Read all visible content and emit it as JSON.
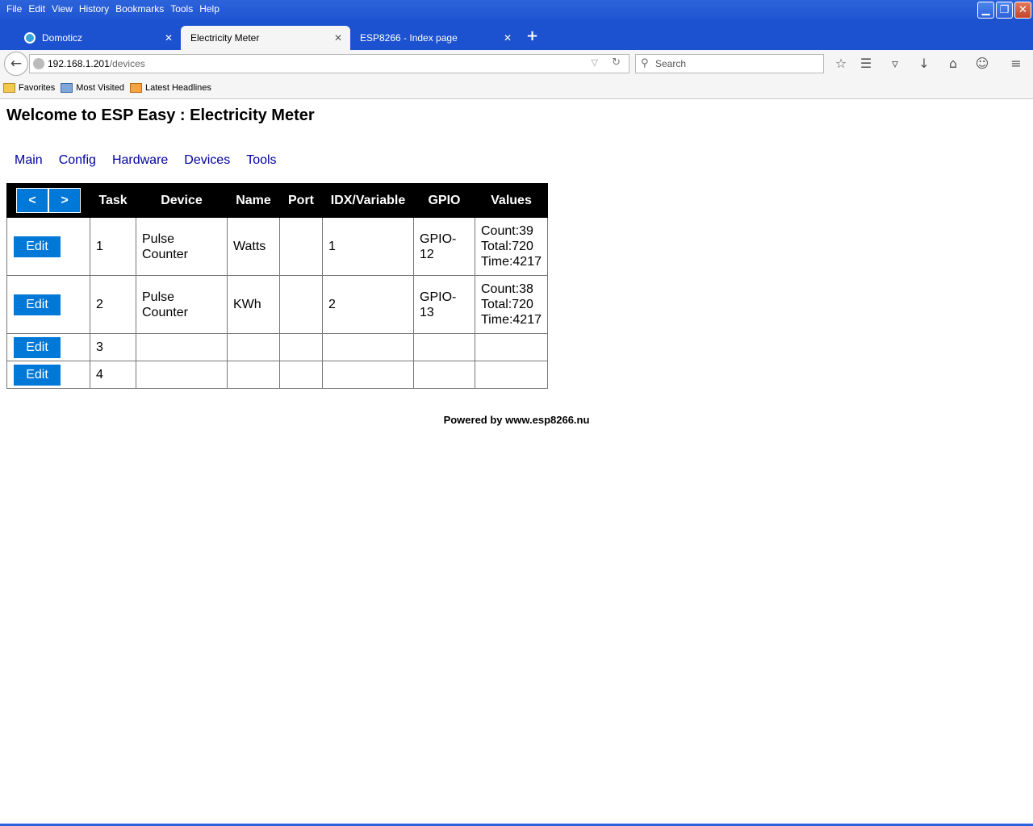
{
  "menubar": {
    "items": [
      "File",
      "Edit",
      "View",
      "History",
      "Bookmarks",
      "Tools",
      "Help"
    ]
  },
  "window_controls": {
    "minimize_icon": "minimize-icon",
    "restore_icon": "restore-icon",
    "close_icon": "close-icon"
  },
  "tabs": [
    {
      "title": "Domoticz",
      "active": false
    },
    {
      "title": "Electricity Meter",
      "active": true
    },
    {
      "title": "ESP8266 - Index page",
      "active": false
    }
  ],
  "navbar": {
    "url_host": "192.168.1.201",
    "url_path": "/devices",
    "search_placeholder": "Search"
  },
  "bookmarks": [
    "Favorites",
    "Most Visited",
    "Latest Headlines"
  ],
  "page": {
    "title": "Welcome to ESP Easy : Electricity Meter",
    "nav": [
      "Main",
      "Config",
      "Hardware",
      "Devices",
      "Tools"
    ],
    "prev_label": "<",
    "next_label": ">",
    "columns": [
      "Task",
      "Device",
      "Name",
      "Port",
      "IDX/Variable",
      "GPIO",
      "Values"
    ],
    "edit_label": "Edit",
    "rows": [
      {
        "task": "1",
        "device": "Pulse Counter",
        "name": "Watts",
        "port": "",
        "idx": "1",
        "gpio": "GPIO-12",
        "values": [
          "Count:39",
          "Total:720",
          "Time:4217"
        ]
      },
      {
        "task": "2",
        "device": "Pulse Counter",
        "name": "KWh",
        "port": "",
        "idx": "2",
        "gpio": "GPIO-13",
        "values": [
          "Count:38",
          "Total:720",
          "Time:4217"
        ]
      },
      {
        "task": "3",
        "device": "",
        "name": "",
        "port": "",
        "idx": "",
        "gpio": "",
        "values": []
      },
      {
        "task": "4",
        "device": "",
        "name": "",
        "port": "",
        "idx": "",
        "gpio": "",
        "values": []
      }
    ],
    "footer": "Powered by www.esp8266.nu"
  }
}
